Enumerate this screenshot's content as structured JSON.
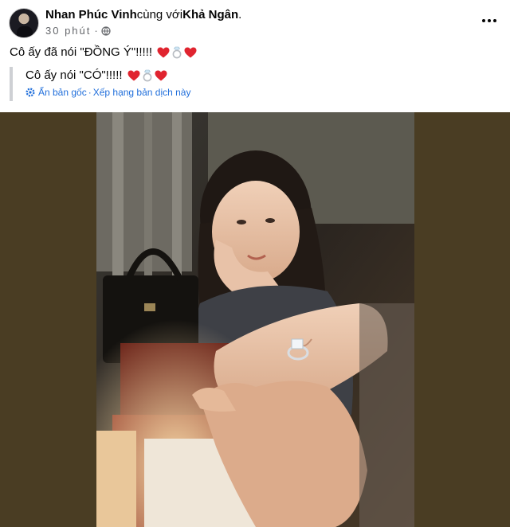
{
  "post": {
    "author": "Nhan Phúc Vinh",
    "with_text": "cùng với",
    "tagged": "Khả Ngân",
    "tagged_suffix": ".",
    "time": "30 phút",
    "separator": "·",
    "caption": "Cô ấy đã nói \"ĐỒNG Ý\"!!!!!",
    "caption_emojis": [
      "red-heart-icon",
      "ring-icon",
      "red-heart-icon"
    ]
  },
  "translation": {
    "text": "Cô ấy nói \"CÓ\"!!!!!",
    "view_original": "Ẩn bản gốc",
    "dot": "·",
    "rate": "Xếp hạng bản dịch này"
  },
  "colors": {
    "photo_background": "#4a3d23",
    "link": "#216fdb",
    "meta": "#65676b",
    "heart": "#e0242f"
  }
}
